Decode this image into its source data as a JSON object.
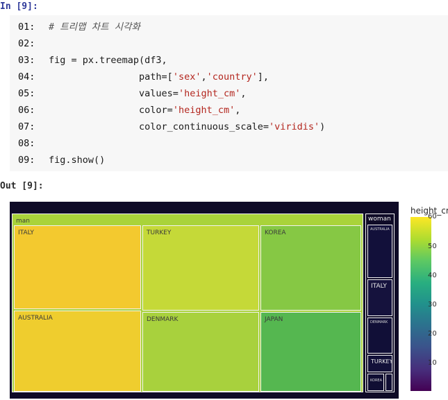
{
  "cell_in": {
    "prompt": "In [9]:",
    "lines": [
      {
        "num": "01:",
        "parts": [
          {
            "t": "# 트리맵 차트 시각화",
            "c": "comment"
          }
        ]
      },
      {
        "num": "02:",
        "parts": []
      },
      {
        "num": "03:",
        "parts": [
          {
            "t": "fig = px.treemap(df3,",
            "c": ""
          }
        ]
      },
      {
        "num": "04:",
        "parts": [
          {
            "t": "                path=[",
            "c": ""
          },
          {
            "t": "'sex'",
            "c": "str"
          },
          {
            "t": ",",
            "c": ""
          },
          {
            "t": "'country'",
            "c": "str"
          },
          {
            "t": "],",
            "c": ""
          }
        ]
      },
      {
        "num": "05:",
        "parts": [
          {
            "t": "                values=",
            "c": ""
          },
          {
            "t": "'height_cm'",
            "c": "str"
          },
          {
            "t": ",",
            "c": ""
          }
        ]
      },
      {
        "num": "06:",
        "parts": [
          {
            "t": "                color=",
            "c": ""
          },
          {
            "t": "'height_cm'",
            "c": "str"
          },
          {
            "t": ",",
            "c": ""
          }
        ]
      },
      {
        "num": "07:",
        "parts": [
          {
            "t": "                color_continuous_scale=",
            "c": ""
          },
          {
            "t": "'viridis'",
            "c": "str"
          },
          {
            "t": ")",
            "c": ""
          }
        ]
      },
      {
        "num": "08:",
        "parts": []
      },
      {
        "num": "09:",
        "parts": [
          {
            "t": "fig.show()",
            "c": ""
          }
        ]
      }
    ]
  },
  "cell_out": {
    "prompt": "Out [9]:"
  },
  "treemap": {
    "groups": [
      {
        "label": "man",
        "color": "#a9d33a"
      },
      {
        "label": "woman",
        "color": "#0f0b27"
      }
    ],
    "man_tiles": [
      {
        "label": "ITALY",
        "color": "#f3c92f"
      },
      {
        "label": "TURKEY",
        "color": "#c5d938"
      },
      {
        "label": "KOREA",
        "color": "#86c844"
      },
      {
        "label": "AUSTRALIA",
        "color": "#efcd2e"
      },
      {
        "label": "DENMARK",
        "color": "#a8d13d"
      },
      {
        "label": "JAPAN",
        "color": "#55b750"
      }
    ],
    "woman_tiles": [
      {
        "label": "AUSTRALIA",
        "color": "#12103a"
      },
      {
        "label": "ITALY",
        "color": "#15123d"
      },
      {
        "label": "DENMARK",
        "color": "#110f37"
      },
      {
        "label": "TURKEY",
        "color": "#131139"
      },
      {
        "label": "KOREA",
        "color": "#100e33"
      },
      {
        "label": "",
        "color": "#100e33"
      }
    ]
  },
  "colorbar": {
    "title": "height_cm",
    "ticks": [
      "60",
      "50",
      "40",
      "30",
      "20",
      "10"
    ]
  }
}
